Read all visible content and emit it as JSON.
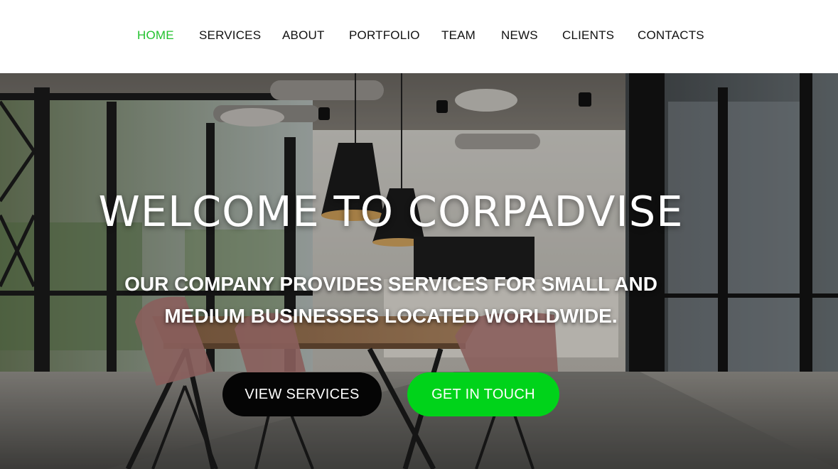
{
  "nav": {
    "items": [
      {
        "label": "HOME",
        "active": true
      },
      {
        "label": "SERVICES",
        "active": false
      },
      {
        "label": "ABOUT",
        "active": false
      },
      {
        "label": "PORTFOLIO",
        "active": false
      },
      {
        "label": "TEAM",
        "active": false
      },
      {
        "label": "NEWS",
        "active": false
      },
      {
        "label": "CLIENTS",
        "active": false
      },
      {
        "label": "CONTACTS",
        "active": false
      }
    ],
    "active_color": "#22c22e"
  },
  "hero": {
    "title": "WELCOME TO CORPADVISE",
    "subtitle_line1": "OUR COMPANY PROVIDES SERVICES FOR SMALL AND",
    "subtitle_line2": "MEDIUM BUSINESSES LOCATED WORLDWIDE.",
    "buttons": {
      "primary_label": "VIEW SERVICES",
      "secondary_label": "GET IN TOUCH"
    },
    "colors": {
      "primary_button": "#050505",
      "secondary_button": "#00d31a"
    }
  }
}
